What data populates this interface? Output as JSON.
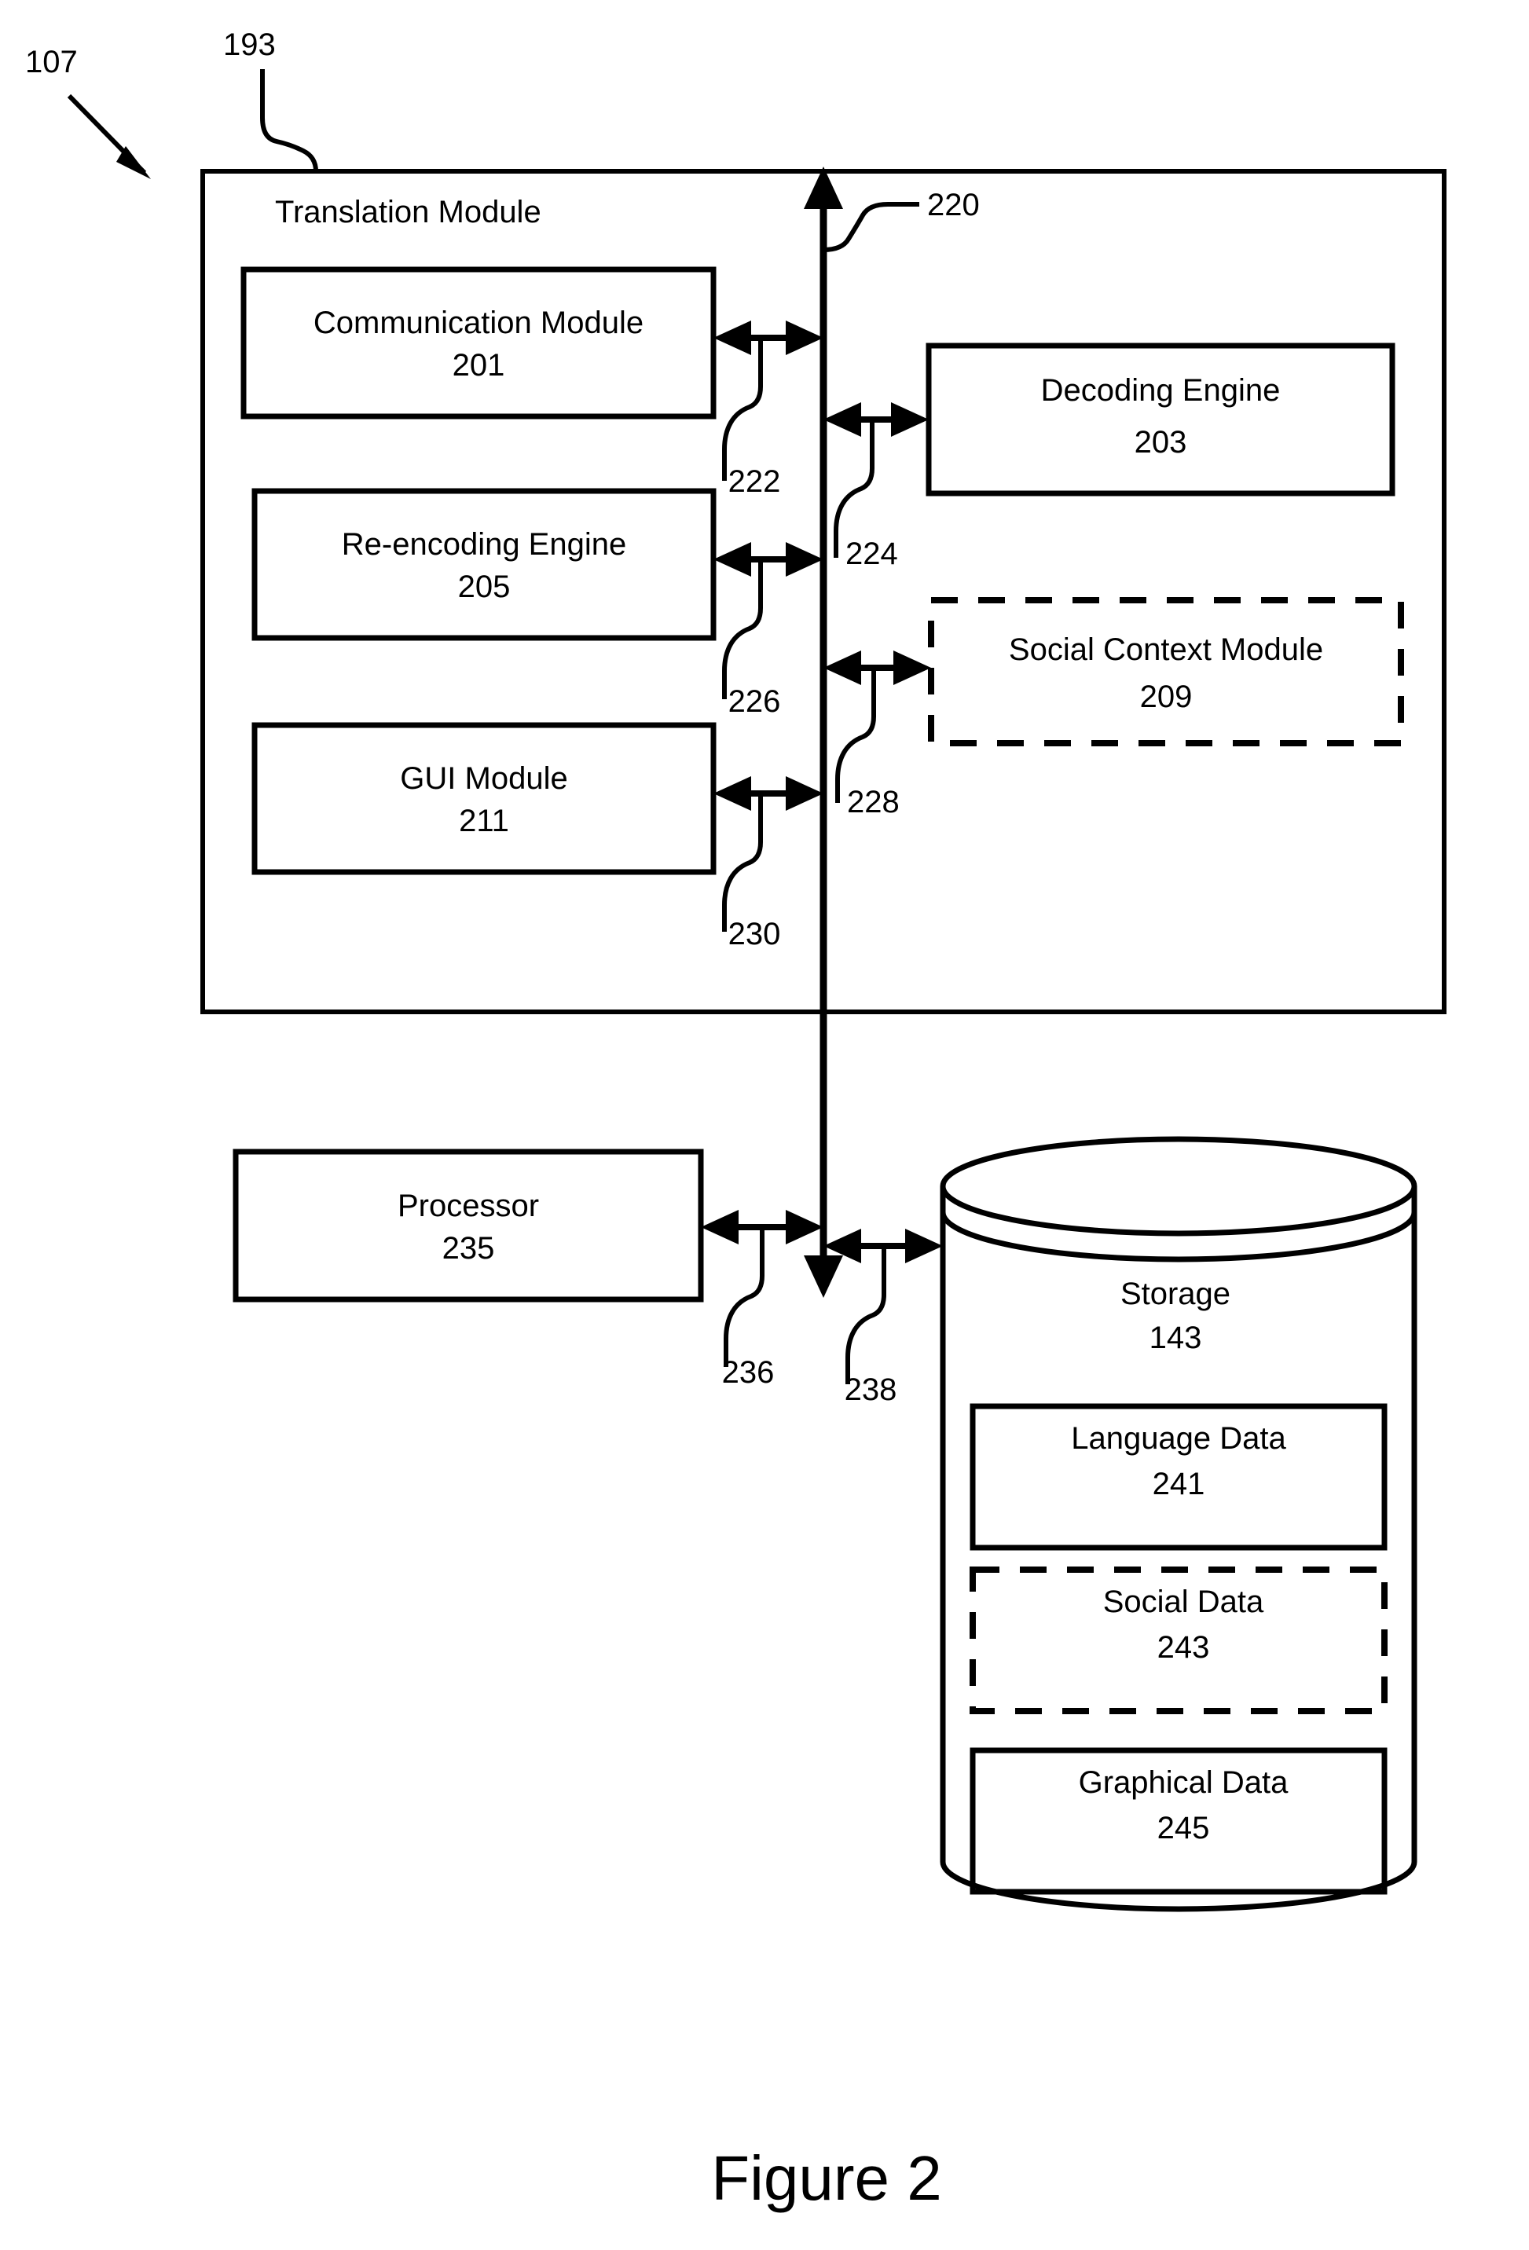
{
  "figure": {
    "caption": "Figure 2",
    "system_ref": "107",
    "container_ref": "193"
  },
  "translation_module": {
    "title": "Translation Module",
    "left_modules": [
      {
        "name": "Communication Module",
        "ref": "201"
      },
      {
        "name": "Re-encoding Engine",
        "ref": "205"
      },
      {
        "name": "GUI Module",
        "ref": "211"
      }
    ],
    "right_modules": [
      {
        "name": "Decoding Engine",
        "ref": "203",
        "style": "solid"
      },
      {
        "name": "Social Context Module",
        "ref": "209",
        "style": "dashed"
      }
    ]
  },
  "bus": {
    "ref": "220",
    "connection_refs": [
      "222",
      "224",
      "226",
      "228",
      "230",
      "236",
      "238"
    ]
  },
  "processor": {
    "name": "Processor",
    "ref": "235"
  },
  "storage": {
    "name": "Storage",
    "ref": "143",
    "items": [
      {
        "name": "Language Data",
        "ref": "241",
        "style": "solid"
      },
      {
        "name": "Social Data",
        "ref": "243",
        "style": "dashed"
      },
      {
        "name": "Graphical Data",
        "ref": "245",
        "style": "solid"
      }
    ]
  }
}
